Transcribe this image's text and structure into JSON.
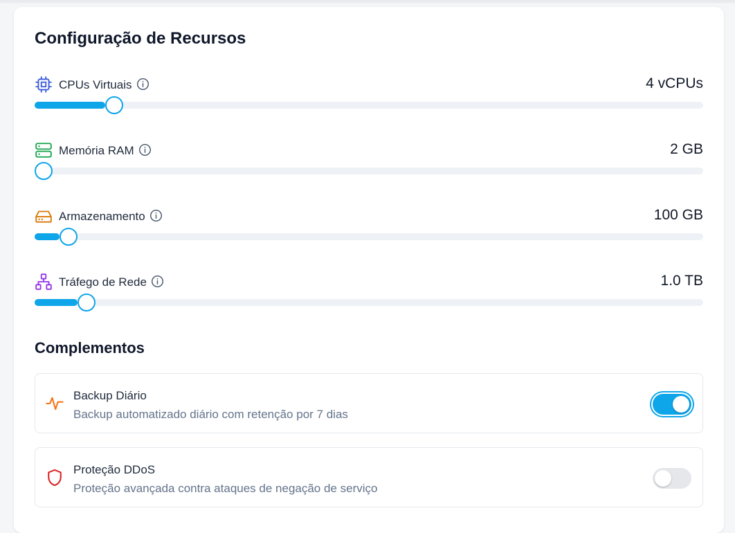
{
  "title": "Configuração de Recursos",
  "resources": [
    {
      "label": "CPUs Virtuais",
      "value": "4 vCPUs",
      "fraction": 0.106,
      "icon": "cpu-icon",
      "color": "#3b5bdb"
    },
    {
      "label": "Memória RAM",
      "value": "2 GB",
      "fraction": 0.0,
      "icon": "memory-icon",
      "color": "#16a34a"
    },
    {
      "label": "Armazenamento",
      "value": "100 GB",
      "fraction": 0.037,
      "icon": "storage-drive-icon",
      "color": "#d97706"
    },
    {
      "label": "Tráfego de Rede",
      "value": "1.0 TB",
      "fraction": 0.064,
      "icon": "network-icon",
      "color": "#9333ea"
    }
  ],
  "addons_title": "Complementos",
  "addons": [
    {
      "name": "Backup Diário",
      "description": "Backup automatizado diário com retenção por 7 dias",
      "enabled": true,
      "icon": "activity-pulse-icon",
      "color": "#f97316"
    },
    {
      "name": "Proteção DDoS",
      "description": "Proteção avançada contra ataques de negação de serviço",
      "enabled": false,
      "icon": "shield-icon",
      "color": "#dc2626"
    }
  ],
  "accent_color": "#0ea5e9"
}
